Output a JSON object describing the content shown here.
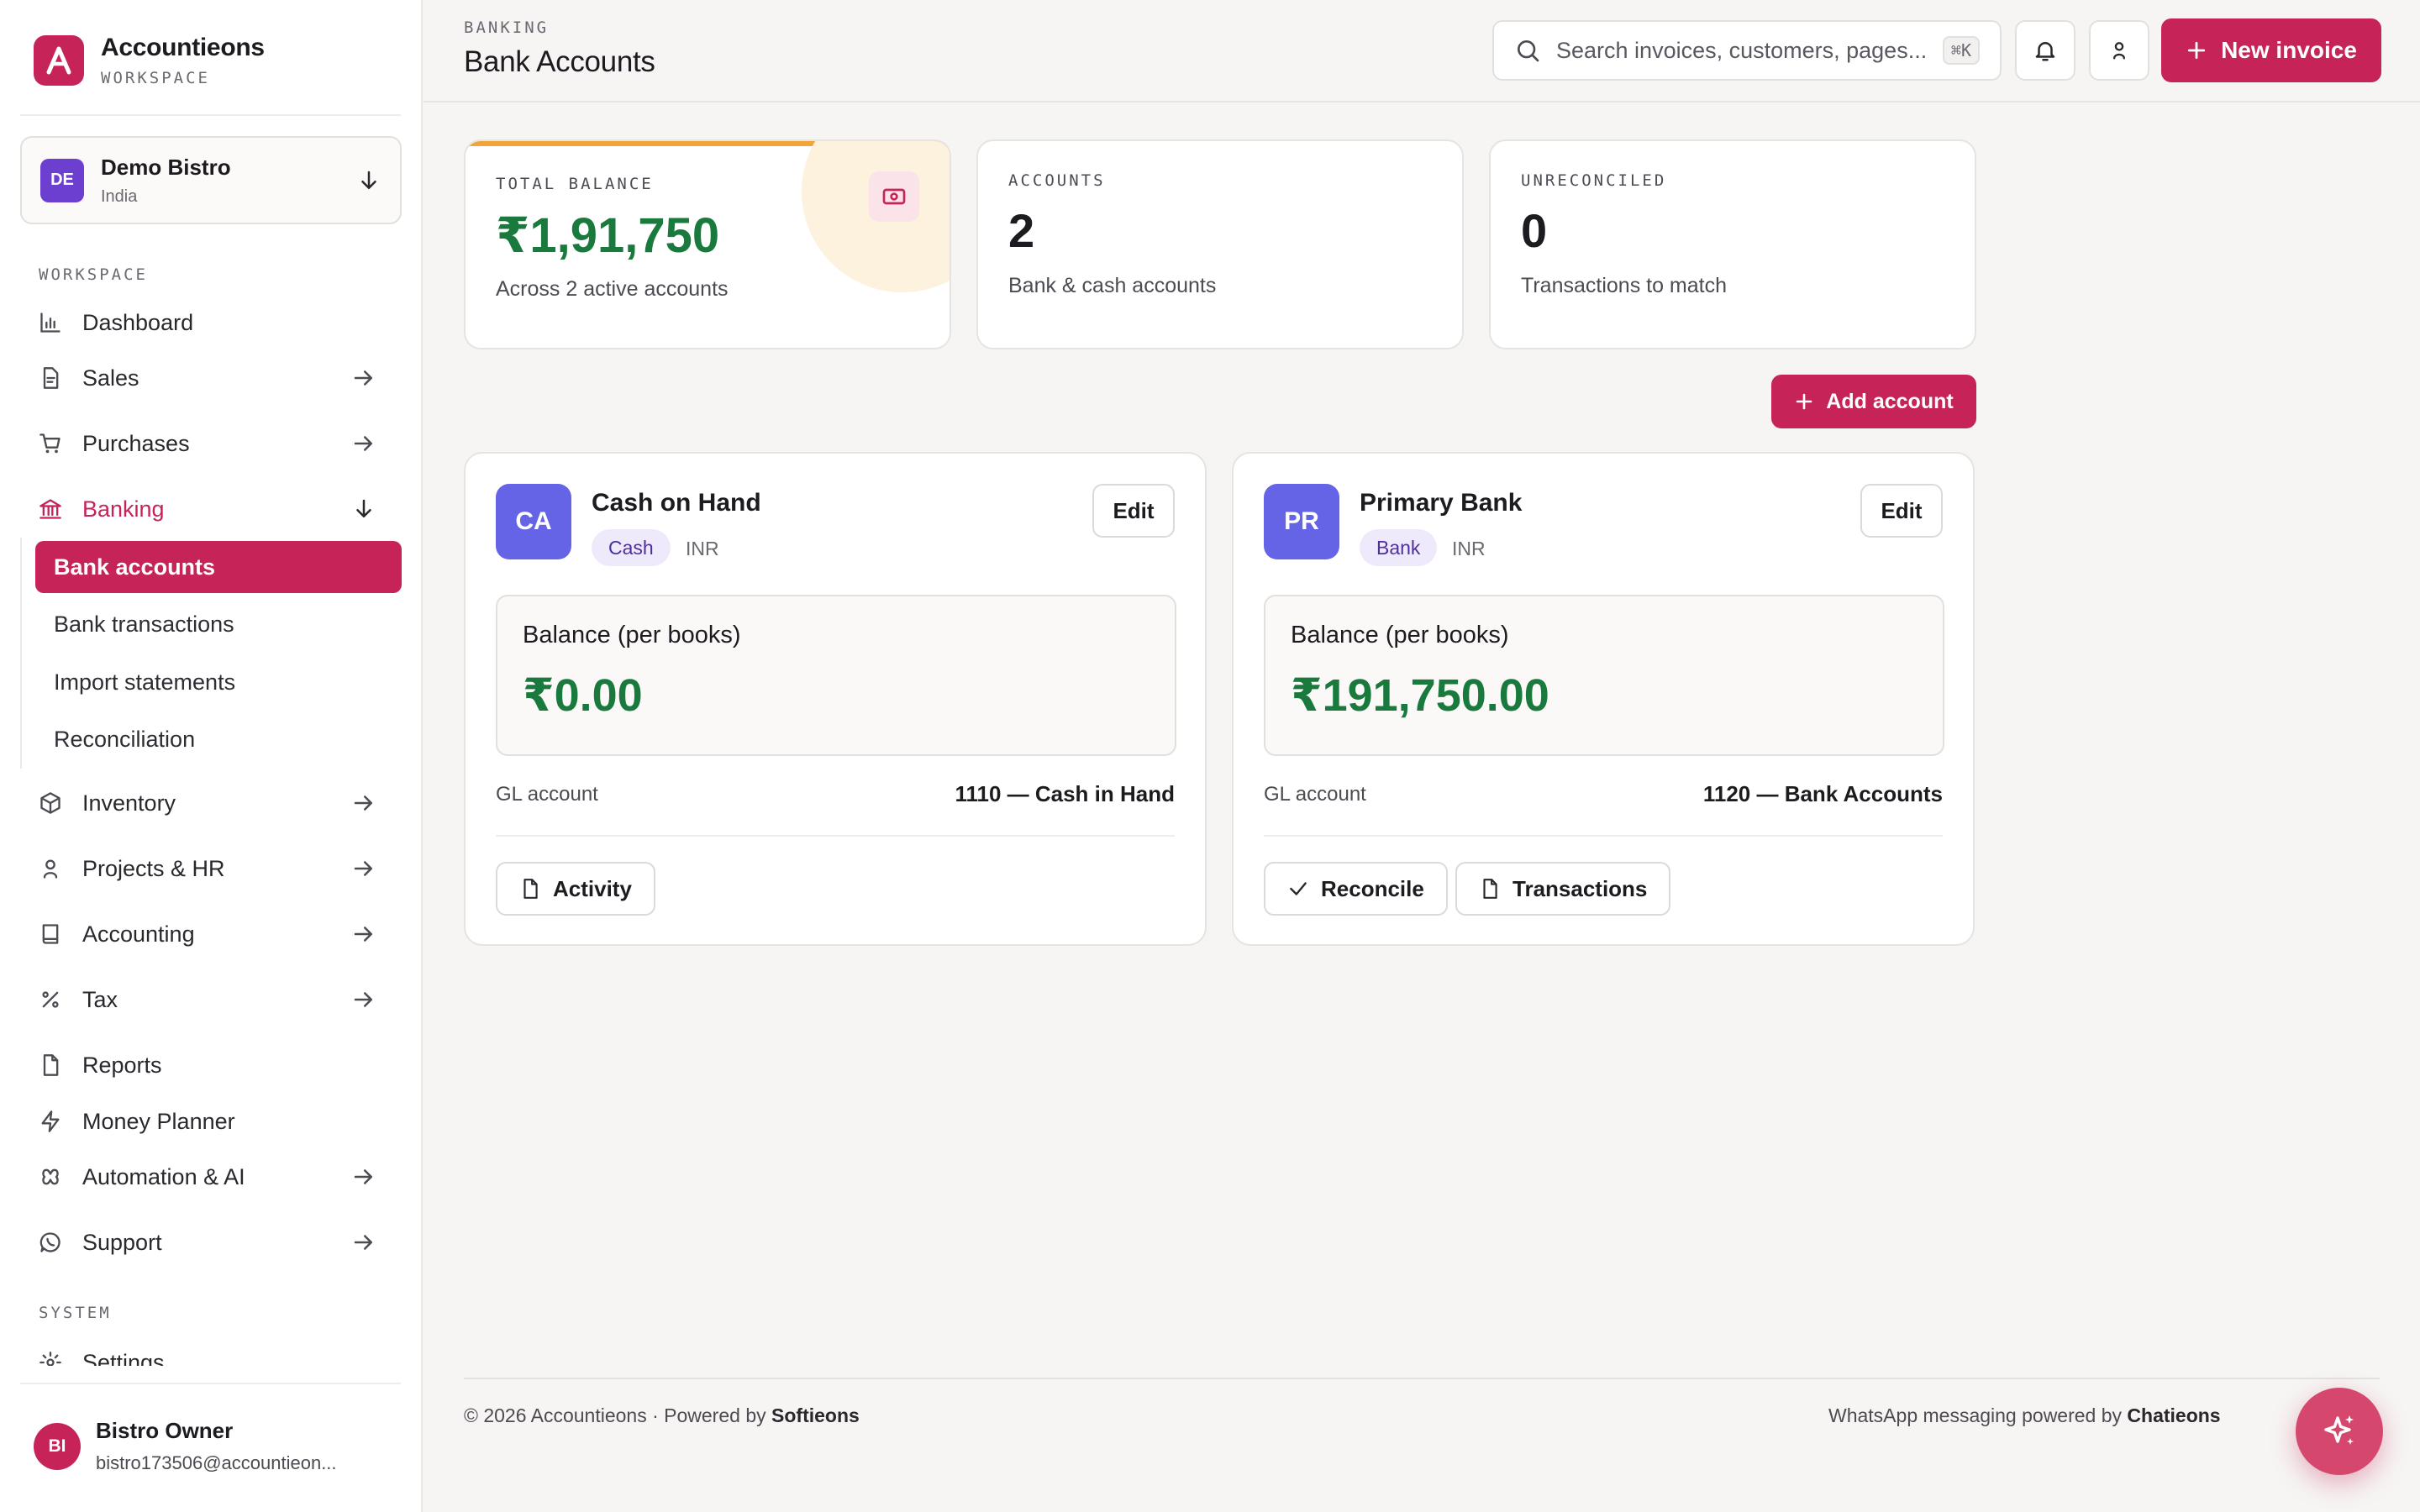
{
  "app": {
    "name": "Accountieons",
    "subtitle": "WORKSPACE",
    "logo_letter": "A"
  },
  "org": {
    "initials": "DE",
    "name": "Demo Bistro",
    "country": "India"
  },
  "sidebar": {
    "section_workspace": "WORKSPACE",
    "section_system": "SYSTEM",
    "items": [
      {
        "label": "Dashboard",
        "icon": "bar-chart-icon"
      },
      {
        "label": "Sales",
        "icon": "document-icon"
      },
      {
        "label": "Purchases",
        "icon": "cart-icon"
      },
      {
        "label": "Banking",
        "icon": "bank-icon"
      },
      {
        "label": "Inventory",
        "icon": "box-icon"
      },
      {
        "label": "Projects & HR",
        "icon": "person-icon"
      },
      {
        "label": "Accounting",
        "icon": "book-icon"
      },
      {
        "label": "Tax",
        "icon": "percent-icon"
      },
      {
        "label": "Reports",
        "icon": "document-icon"
      },
      {
        "label": "Money Planner",
        "icon": "lightning-icon"
      },
      {
        "label": "Automation & AI",
        "icon": "automation-icon"
      },
      {
        "label": "Support",
        "icon": "whatsapp-icon"
      },
      {
        "label": "Settings",
        "icon": "gear-icon"
      }
    ],
    "banking_sub": [
      {
        "label": "Bank accounts"
      },
      {
        "label": "Bank transactions"
      },
      {
        "label": "Import statements"
      },
      {
        "label": "Reconciliation"
      }
    ]
  },
  "user": {
    "initials": "BI",
    "name": "Bistro Owner",
    "email": "bistro173506@accountieon..."
  },
  "header": {
    "breadcrumb": "BANKING",
    "title": "Bank Accounts",
    "search_placeholder": "Search invoices, customers, pages...",
    "search_shortcut": "⌘K",
    "new_invoice_label": "New invoice"
  },
  "stats": {
    "total_balance": {
      "label": "TOTAL BALANCE",
      "value": "₹1,91,750",
      "sub": "Across 2 active accounts"
    },
    "accounts": {
      "label": "ACCOUNTS",
      "value": "2",
      "sub": "Bank & cash accounts"
    },
    "unreconciled": {
      "label": "UNRECONCILED",
      "value": "0",
      "sub": "Transactions to match"
    }
  },
  "add_account_label": "Add account",
  "accounts": [
    {
      "initials": "CA",
      "name": "Cash on Hand",
      "type": "Cash",
      "currency": "INR",
      "edit_label": "Edit",
      "balance_label": "Balance (per books)",
      "balance": "₹0.00",
      "gl_label": "GL account",
      "gl_value": "1110 — Cash in Hand",
      "actions": [
        "Activity"
      ]
    },
    {
      "initials": "PR",
      "name": "Primary Bank",
      "type": "Bank",
      "currency": "INR",
      "edit_label": "Edit",
      "balance_label": "Balance (per books)",
      "balance": "₹191,750.00",
      "gl_label": "GL account",
      "gl_value": "1120 — Bank Accounts",
      "actions": [
        "Reconcile",
        "Transactions"
      ]
    }
  ],
  "footer": {
    "copyright": "© 2026 Accountieons · Powered by ",
    "powered_by": "Softieons",
    "whatsapp_text": "WhatsApp messaging powered by ",
    "whatsapp_brand": "Chatieons"
  },
  "colors": {
    "accent": "#c62458",
    "balance_green": "#1a7a3e",
    "avatar_indigo": "#6563e6",
    "org_purple": "#6d3fd1",
    "total_bar": "#f2a33a"
  }
}
